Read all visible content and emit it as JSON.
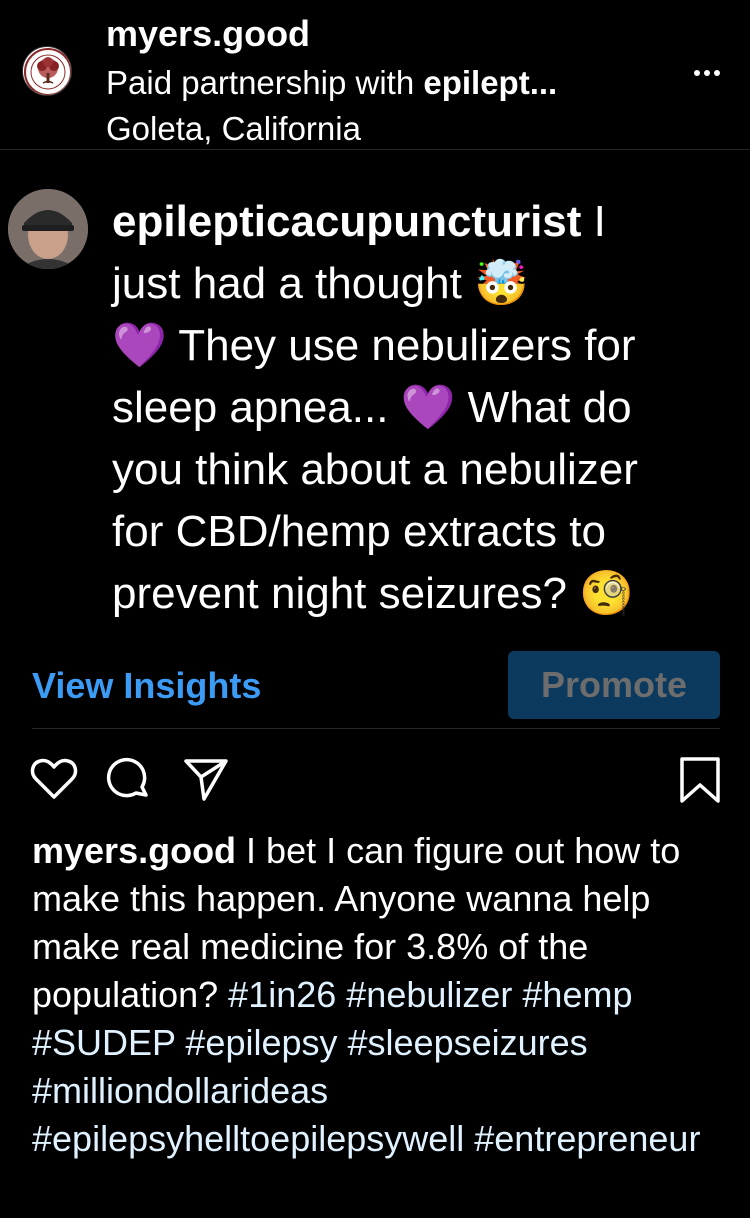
{
  "header": {
    "username": "myers.good",
    "partnership_prefix": "Paid partnership with ",
    "partner_name": "epilept...",
    "location": "Goleta, California",
    "avatar_text_top": "THE TREE",
    "avatar_text_bottom": "MYERS GOOD"
  },
  "post": {
    "username": "epilepticacupuncturist",
    "text_line1": " I",
    "text_line2": "just had a thought 🤯",
    "text_line3": "💜 They use nebulizers for",
    "text_line4": "sleep apnea... 💜 What do",
    "text_line5": "you think about a nebulizer",
    "text_line6": "for CBD/hemp extracts to",
    "text_line7": "prevent night seizures? 🧐"
  },
  "insights": {
    "view_label": "View Insights",
    "promote_label": "Promote"
  },
  "actions": {
    "icons": [
      "heart-icon",
      "comment-icon",
      "share-icon",
      "bookmark-icon"
    ]
  },
  "caption": {
    "username": "myers.good",
    "text": " I bet I can figure out how to make this happen. Anyone wanna help make real medicine for 3.8% of the population? ",
    "hashtags": "#1in26 #nebulizer #hemp #SUDEP #epilepsy #sleepseizures #milliondollarideas #epilepsyhelltoepilepsywell #entrepreneur"
  },
  "colors": {
    "background": "#000000",
    "link_blue": "#3b9bf5",
    "promote_bg": "#0c3a5e",
    "promote_text": "#6d6d6d"
  }
}
